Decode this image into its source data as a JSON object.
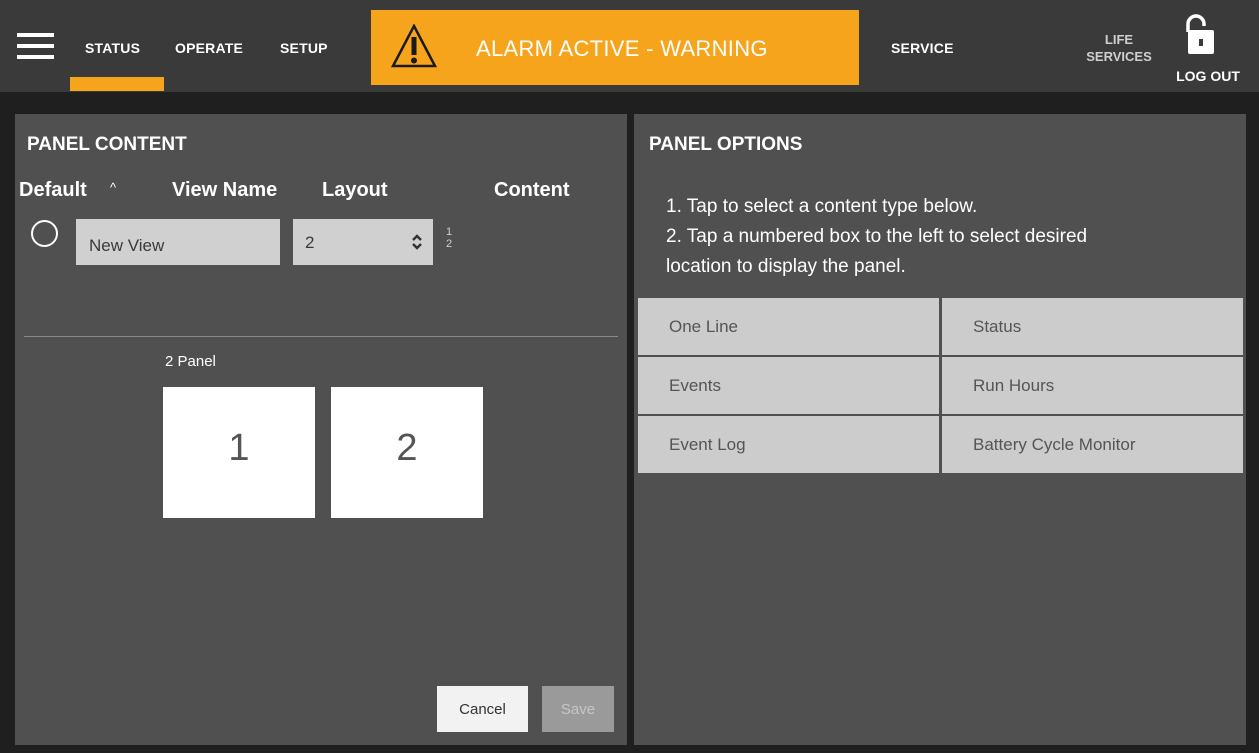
{
  "nav": {
    "status": "STATUS",
    "operate": "OPERATE",
    "setup": "SETUP",
    "service": "SERVICE",
    "life_services_line1": "LIFE",
    "life_services_line2": "SERVICES",
    "logout": "LOG OUT",
    "active_tab": "STATUS"
  },
  "alarm": {
    "text": "ALARM ACTIVE - WARNING",
    "color": "#f7a41d"
  },
  "panel_content": {
    "title": "PANEL CONTENT",
    "columns": {
      "default": "Default",
      "view_name": "View Name",
      "layout": "Layout",
      "content": "Content"
    },
    "row": {
      "view_name_value": "New View",
      "layout_value": "2",
      "content_numbers": [
        "1",
        "2"
      ]
    },
    "layout_caption": "2 Panel",
    "slots": [
      "1",
      "2"
    ],
    "cancel_label": "Cancel",
    "save_label": "Save"
  },
  "panel_options": {
    "title": "PANEL OPTIONS",
    "instruction_1": "1. Tap to select a content type below.",
    "instruction_2a": "2. Tap a numbered box to the left to select desired",
    "instruction_2b": "location to display the panel.",
    "options": [
      "One Line",
      "Status",
      "Events",
      "Run Hours",
      "Event Log",
      "Battery Cycle Monitor"
    ]
  },
  "colors": {
    "topbar": "#3a3a3a",
    "panel": "#505050",
    "accent": "#f7a41d",
    "option_cell": "#cccccc"
  }
}
